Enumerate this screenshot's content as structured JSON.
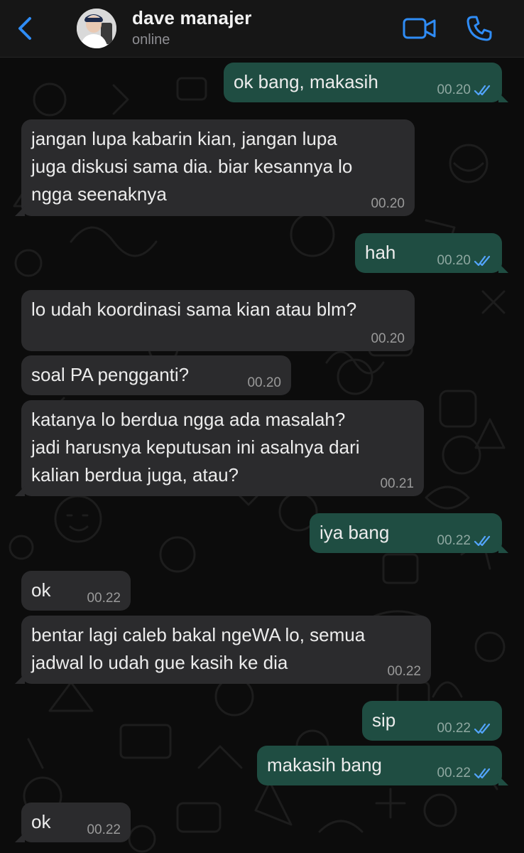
{
  "header": {
    "contact_name": "dave manajer",
    "contact_status": "online",
    "accent_color": "#2f8cf5"
  },
  "messages": [
    {
      "dir": "out",
      "text": "ok bang, makasih",
      "time": "00.20",
      "read": true
    },
    {
      "dir": "in",
      "lines": [
        "jangan lupa kabarin kian, jangan lupa",
        "juga diskusi sama dia. biar kesannya lo",
        "ngga seenaknya"
      ],
      "time": "00.20"
    },
    {
      "dir": "out",
      "text": "hah",
      "time": "00.20",
      "read": true
    },
    {
      "dir": "in",
      "text": "lo udah koordinasi sama kian atau blm?",
      "time": "00.20"
    },
    {
      "dir": "in",
      "text": "soal PA pengganti?",
      "time": "00.20"
    },
    {
      "dir": "in",
      "lines": [
        "katanya lo berdua ngga ada masalah?",
        "jadi harusnya keputusan ini asalnya dari",
        "kalian berdua juga, atau?"
      ],
      "time": "00.21"
    },
    {
      "dir": "out",
      "text": "iya bang",
      "time": "00.22",
      "read": true
    },
    {
      "dir": "in",
      "text": "ok",
      "time": "00.22"
    },
    {
      "dir": "in",
      "lines": [
        "bentar lagi caleb bakal ngeWA lo, semua",
        "jadwal lo udah gue kasih ke dia"
      ],
      "time": "00.22"
    },
    {
      "dir": "out",
      "text": "sip",
      "time": "00.22",
      "read": true
    },
    {
      "dir": "out",
      "text": "makasih bang",
      "time": "00.22",
      "read": true
    },
    {
      "dir": "in",
      "text": "ok",
      "time": "00.22"
    }
  ],
  "icons": [
    "back-chevron-icon",
    "video-call-icon",
    "phone-icon",
    "double-check-icon"
  ]
}
